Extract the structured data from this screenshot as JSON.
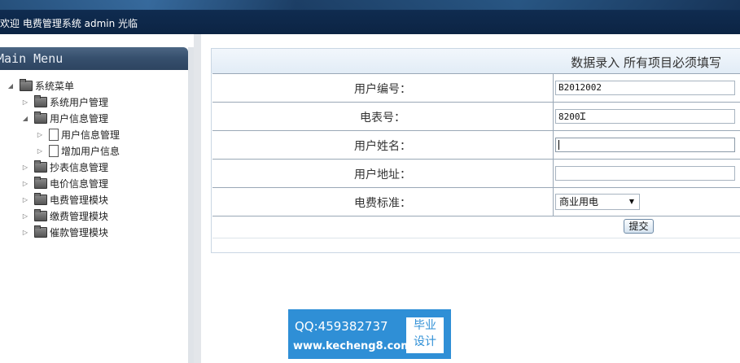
{
  "header": {
    "welcome": "欢迎 电费管理系统 admin 光临"
  },
  "sidebar": {
    "title": "Main Menu",
    "tree": [
      {
        "label": "系统菜单",
        "expanded": true,
        "icon": "folder-icon"
      },
      {
        "label": "系统用户管理",
        "icon": "folder-icon"
      },
      {
        "label": "用户信息管理",
        "expanded": true,
        "icon": "folder-icon"
      },
      {
        "label": "用户信息管理",
        "icon": "document-icon"
      },
      {
        "label": "增加用户信息",
        "icon": "document-icon"
      },
      {
        "label": "抄表信息管理",
        "icon": "folder-icon"
      },
      {
        "label": "电价信息管理",
        "icon": "folder-icon"
      },
      {
        "label": "电费管理模块",
        "icon": "folder-icon"
      },
      {
        "label": "缴费管理模块",
        "icon": "folder-icon"
      },
      {
        "label": "催款管理模块",
        "icon": "folder-icon"
      }
    ]
  },
  "form": {
    "header": "数据录入  所有项目必须填写",
    "fields": [
      {
        "label": "用户编号：",
        "value": "B2012002"
      },
      {
        "label": "电表号：",
        "value": "8200"
      },
      {
        "label": "用户姓名：",
        "value": ""
      },
      {
        "label": "用户地址：",
        "value": ""
      },
      {
        "label": "电费标准：",
        "value": "商业用电"
      }
    ],
    "submit_label": "提交"
  },
  "ad": {
    "qq": "QQ:459382737",
    "url": "www.kecheng8.com",
    "badge_line1": "毕业",
    "badge_line2": "设计"
  }
}
